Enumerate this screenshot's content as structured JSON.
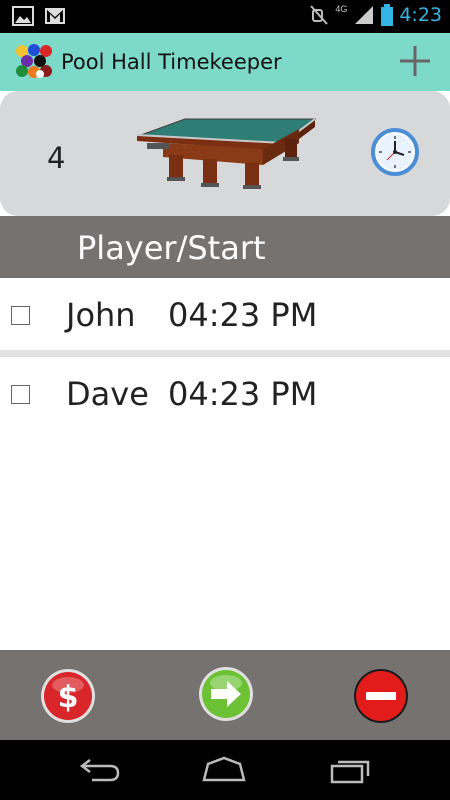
{
  "status_bar": {
    "time": "4:23",
    "network_label": "4G"
  },
  "action_bar": {
    "title": "Pool Hall Timekeeper",
    "add_icon": "plus-icon"
  },
  "table_card": {
    "table_number": "4",
    "table_image": "pool-table-image",
    "timer_icon": "clock-icon"
  },
  "list_header": {
    "label": "Player/Start"
  },
  "players": [
    {
      "name": "John",
      "start": "04:23 PM",
      "checked": false
    },
    {
      "name": "Dave",
      "start": "04:23 PM",
      "checked": false
    }
  ],
  "bottom_actions": {
    "pay_icon": "dollar-icon",
    "next_icon": "arrow-right-icon",
    "remove_icon": "minus-icon",
    "colors": {
      "pay": "#d9262a",
      "next": "#6cc234",
      "remove": "#e21b1b"
    }
  },
  "nav_bar": {
    "back_icon": "back-icon",
    "home_icon": "home-icon",
    "recent_icon": "recent-apps-icon"
  },
  "colors": {
    "action_bar": "#7ddac9",
    "header_bar": "#767270",
    "card": "#d7d8d9",
    "clock_accent": "#33b5e5"
  }
}
